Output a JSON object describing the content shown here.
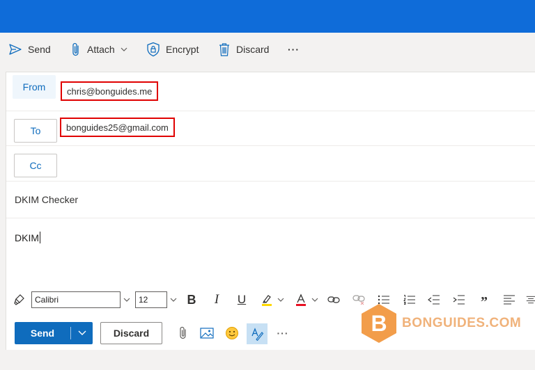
{
  "toolbar": {
    "send_label": "Send",
    "attach_label": "Attach",
    "encrypt_label": "Encrypt",
    "discard_label": "Discard",
    "more_label": "···"
  },
  "compose": {
    "from_label": "From",
    "from_value": "chris@bonguides.me",
    "to_label": "To",
    "to_value": "bonguides25@gmail.com",
    "cc_label": "Cc",
    "subject": "DKIM Checker",
    "body": "DKIM"
  },
  "format": {
    "font_name": "Calibri",
    "font_size": "12",
    "bold_glyph": "B",
    "italic_glyph": "I",
    "underline_glyph": "U",
    "quote_glyph": "”"
  },
  "actions": {
    "send_label": "Send",
    "discard_label": "Discard",
    "more_label": "···"
  },
  "watermark": {
    "logo_letter": "B",
    "text": "BONGUIDES.COM"
  },
  "colors": {
    "accent": "#0f6cbd",
    "topbar": "#0f6cd9",
    "highlight_red": "#e00000",
    "watermark": "#f0a050"
  }
}
